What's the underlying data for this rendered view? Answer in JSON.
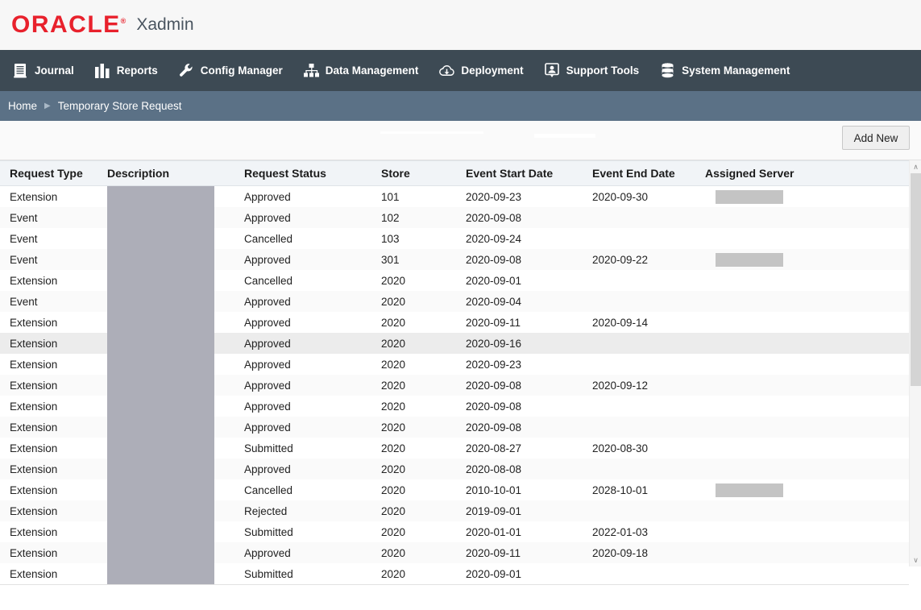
{
  "brand": {
    "logo_text": "ORACLE",
    "logo_reg": "®",
    "app_name": "Xadmin",
    "logo_color": "#e8212c"
  },
  "nav": {
    "items": [
      {
        "label": "Journal",
        "icon": "journal-book-icon"
      },
      {
        "label": "Reports",
        "icon": "bar-chart-icon"
      },
      {
        "label": "Config Manager",
        "icon": "wrench-icon"
      },
      {
        "label": "Data Management",
        "icon": "org-chart-icon"
      },
      {
        "label": "Deployment",
        "icon": "cloud-download-icon"
      },
      {
        "label": "Support Tools",
        "icon": "support-person-icon"
      },
      {
        "label": "System Management",
        "icon": "database-stack-icon"
      }
    ],
    "background": "#3d4a54"
  },
  "breadcrumb": {
    "home": "Home",
    "separator": "▶",
    "current": "Temporary Store Request",
    "background": "#5b7186"
  },
  "toolbar": {
    "add_new_label": "Add New"
  },
  "table": {
    "columns": [
      "Request Type",
      "Description",
      "Request Status",
      "Store",
      "Event Start Date",
      "Event End Date",
      "Assigned Server"
    ],
    "selected_row_index": 7,
    "rows": [
      {
        "request_type": "Extension",
        "description": "",
        "request_status": "Approved",
        "store": "101",
        "event_start_date": "2020-09-23",
        "event_end_date": "2020-09-30",
        "assigned_server": "",
        "server_redacted": true
      },
      {
        "request_type": "Event",
        "description": "",
        "request_status": "Approved",
        "store": "102",
        "event_start_date": "2020-09-08",
        "event_end_date": "",
        "assigned_server": "",
        "server_redacted": false
      },
      {
        "request_type": "Event",
        "description": "",
        "request_status": "Cancelled",
        "store": "103",
        "event_start_date": "2020-09-24",
        "event_end_date": "",
        "assigned_server": "",
        "server_redacted": false
      },
      {
        "request_type": "Event",
        "description": "",
        "request_status": "Approved",
        "store": "301",
        "event_start_date": "2020-09-08",
        "event_end_date": "2020-09-22",
        "assigned_server": "",
        "server_redacted": true
      },
      {
        "request_type": "Extension",
        "description": "",
        "request_status": "Cancelled",
        "store": "2020",
        "event_start_date": "2020-09-01",
        "event_end_date": "",
        "assigned_server": "",
        "server_redacted": false
      },
      {
        "request_type": "Event",
        "description": "",
        "request_status": "Approved",
        "store": "2020",
        "event_start_date": "2020-09-04",
        "event_end_date": "",
        "assigned_server": "",
        "server_redacted": false
      },
      {
        "request_type": "Extension",
        "description": "",
        "request_status": "Approved",
        "store": "2020",
        "event_start_date": "2020-09-11",
        "event_end_date": "2020-09-14",
        "assigned_server": "",
        "server_redacted": false
      },
      {
        "request_type": "Extension",
        "description": "",
        "request_status": "Approved",
        "store": "2020",
        "event_start_date": "2020-09-16",
        "event_end_date": "",
        "assigned_server": "",
        "server_redacted": false
      },
      {
        "request_type": "Extension",
        "description": "",
        "request_status": "Approved",
        "store": "2020",
        "event_start_date": "2020-09-23",
        "event_end_date": "",
        "assigned_server": "",
        "server_redacted": false
      },
      {
        "request_type": "Extension",
        "description": "",
        "request_status": "Approved",
        "store": "2020",
        "event_start_date": "2020-09-08",
        "event_end_date": "2020-09-12",
        "assigned_server": "",
        "server_redacted": false
      },
      {
        "request_type": "Extension",
        "description": "",
        "request_status": "Approved",
        "store": "2020",
        "event_start_date": "2020-09-08",
        "event_end_date": "",
        "assigned_server": "",
        "server_redacted": false
      },
      {
        "request_type": "Extension",
        "description": "",
        "request_status": "Approved",
        "store": "2020",
        "event_start_date": "2020-09-08",
        "event_end_date": "",
        "assigned_server": "",
        "server_redacted": false
      },
      {
        "request_type": "Extension",
        "description": "",
        "request_status": "Submitted",
        "store": "2020",
        "event_start_date": "2020-08-27",
        "event_end_date": "2020-08-30",
        "assigned_server": "",
        "server_redacted": false
      },
      {
        "request_type": "Extension",
        "description": "",
        "request_status": "Approved",
        "store": "2020",
        "event_start_date": "2020-08-08",
        "event_end_date": "",
        "assigned_server": "",
        "server_redacted": false
      },
      {
        "request_type": "Extension",
        "description": "",
        "request_status": "Cancelled",
        "store": "2020",
        "event_start_date": "2010-10-01",
        "event_end_date": "2028-10-01",
        "assigned_server": "",
        "server_redacted": true
      },
      {
        "request_type": "Extension",
        "description": "",
        "request_status": "Rejected",
        "store": "2020",
        "event_start_date": "2019-09-01",
        "event_end_date": "",
        "assigned_server": "",
        "server_redacted": false
      },
      {
        "request_type": "Extension",
        "description": "",
        "request_status": "Submitted",
        "store": "2020",
        "event_start_date": "2020-01-01",
        "event_end_date": "2022-01-03",
        "assigned_server": "",
        "server_redacted": false
      },
      {
        "request_type": "Extension",
        "description": "",
        "request_status": "Approved",
        "store": "2020",
        "event_start_date": "2020-09-11",
        "event_end_date": "2020-09-18",
        "assigned_server": "",
        "server_redacted": false
      },
      {
        "request_type": "Extension",
        "description": "",
        "request_status": "Submitted",
        "store": "2020",
        "event_start_date": "2020-09-01",
        "event_end_date": "",
        "assigned_server": "",
        "server_redacted": false
      }
    ]
  },
  "scrollbar": {
    "up_arrow": "∧",
    "down_arrow": "∨"
  }
}
